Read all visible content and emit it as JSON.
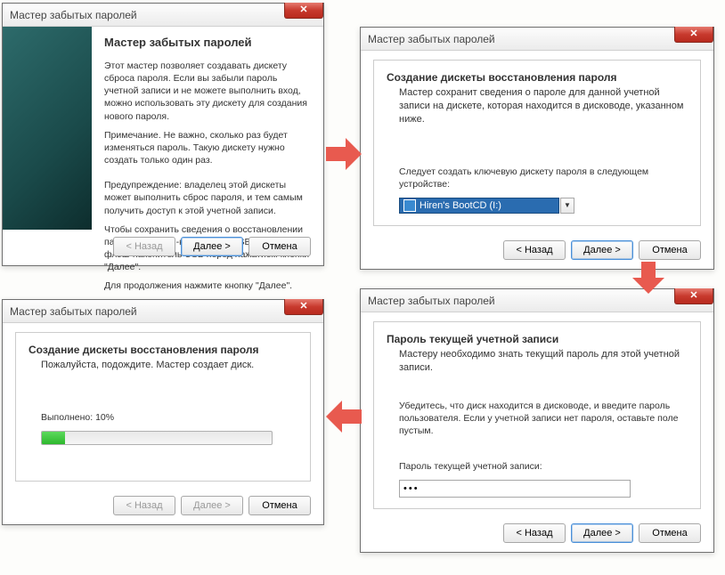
{
  "common": {
    "window_title": "Мастер забытых паролей",
    "btn_back": "< Назад",
    "btn_next": "Далее >",
    "btn_cancel": "Отмена"
  },
  "d1": {
    "title": "Мастер забытых паролей",
    "p1": "Этот мастер позволяет создавать дискету сброса пароля. Если вы забыли пароль учетной записи и не можете выполнить вход, можно использовать эту дискету для создания нового пароля.",
    "p2": "Примечание. Не важно, сколько раз будет изменяться пароль. Такую дискету нужно создать только один раз.",
    "p3": "Предупреждение: владелец этой дискеты может выполнить сброс пароля, и тем самым получить доступ к этой учетной записи.",
    "p4": "Чтобы сохранить сведения о восстановлении пароля на флэш-накопителе USB, вставьте флэш-накопитель USB перед нажатием кнопки \"Далее\".",
    "p5": "Для продолжения нажмите кнопку \"Далее\"."
  },
  "d2": {
    "heading": "Создание дискеты восстановления пароля",
    "sub": "Мастер сохранит сведения о пароле для данной учетной записи на дискете, которая находится в дисководе, указанном ниже.",
    "label": "Следует создать ключевую дискету пароля в следующем устройстве:",
    "combo_value": "Hiren's BootCD (I:)"
  },
  "d3": {
    "heading": "Пароль текущей учетной записи",
    "sub": "Мастеру необходимо знать текущий пароль для этой учетной записи.",
    "body": "Убедитесь, что диск находится в дисководе, и введите пароль пользователя. Если у учетной записи нет пароля, оставьте поле пустым.",
    "label": "Пароль текущей учетной записи:",
    "pwd_mask": "●●●"
  },
  "d4": {
    "heading": "Создание дискеты восстановления пароля",
    "sub": "Пожалуйста, подождите. Мастер создает диск.",
    "progress_label": "Выполнено: 10%",
    "progress_pct": 10
  }
}
